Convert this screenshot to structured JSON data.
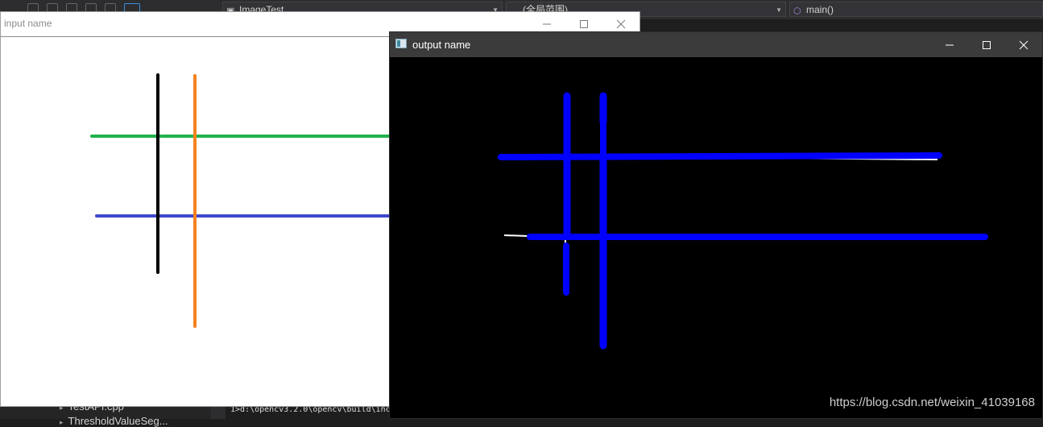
{
  "ide": {
    "project_dropdown": "ImageTest",
    "scope_dropdown": "(全局范围)",
    "function_dropdown": "main()",
    "solution_items": [
      "TestAPI.cpp",
      "ThresholdValueSeg..."
    ],
    "output_line": "1>d:\\opencv3.2.0\\opencv\\build\\inc"
  },
  "input_window": {
    "title": "input name",
    "lines": [
      {
        "name": "black-vertical-line",
        "color": "#000000"
      },
      {
        "name": "orange-vertical-line",
        "color": "#f58220"
      },
      {
        "name": "green-horizontal-line",
        "color": "#22b14c"
      },
      {
        "name": "indigo-horizontal-line",
        "color": "#3f48cc"
      }
    ]
  },
  "output_window": {
    "title": "output name",
    "line_color": "#0000ff",
    "edge_color": "#ffffff",
    "background": "#000000"
  },
  "watermark": "https://blog.csdn.net/weixin_41039168"
}
